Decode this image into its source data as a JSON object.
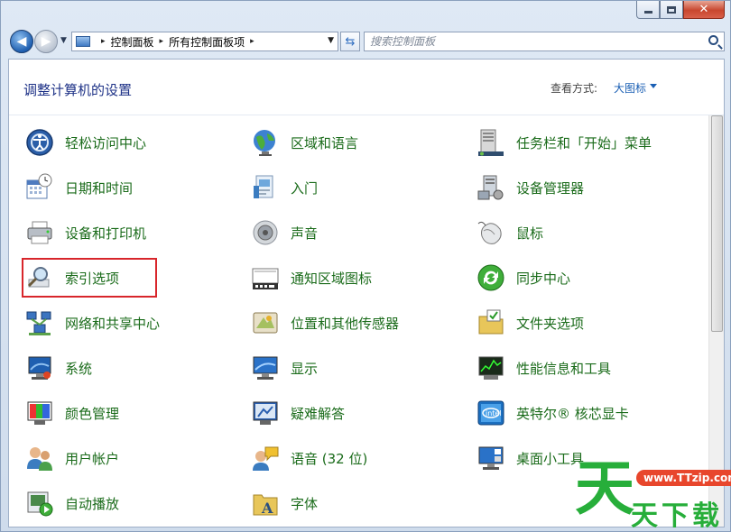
{
  "window": {
    "caption": {
      "min": "–",
      "max": "□",
      "close": "✕"
    }
  },
  "nav": {
    "breadcrumb": [
      "控制面板",
      "所有控制面板项"
    ],
    "sep": "▸",
    "search_placeholder": "搜索控制面板"
  },
  "header": {
    "title": "调整计算机的设置",
    "view_by_label": "查看方式:",
    "view_by_value": "大图标"
  },
  "items": [
    {
      "label": "轻松访问中心",
      "icon": "ease-of-access-icon"
    },
    {
      "label": "区域和语言",
      "icon": "globe-icon"
    },
    {
      "label": "任务栏和「开始」菜单",
      "icon": "taskbar-icon"
    },
    {
      "label": "日期和时间",
      "icon": "calendar-clock-icon"
    },
    {
      "label": "入门",
      "icon": "getting-started-icon"
    },
    {
      "label": "设备管理器",
      "icon": "device-manager-icon"
    },
    {
      "label": "设备和打印机",
      "icon": "printer-icon"
    },
    {
      "label": "声音",
      "icon": "speaker-icon"
    },
    {
      "label": "鼠标",
      "icon": "mouse-icon"
    },
    {
      "label": "索引选项",
      "icon": "indexing-icon"
    },
    {
      "label": "通知区域图标",
      "icon": "notification-area-icon"
    },
    {
      "label": "同步中心",
      "icon": "sync-icon"
    },
    {
      "label": "网络和共享中心",
      "icon": "network-icon"
    },
    {
      "label": "位置和其他传感器",
      "icon": "sensor-icon"
    },
    {
      "label": "文件夹选项",
      "icon": "folder-options-icon"
    },
    {
      "label": "系统",
      "icon": "system-icon"
    },
    {
      "label": "显示",
      "icon": "display-icon"
    },
    {
      "label": "性能信息和工具",
      "icon": "performance-icon"
    },
    {
      "label": "颜色管理",
      "icon": "color-management-icon"
    },
    {
      "label": "疑难解答",
      "icon": "troubleshooting-icon"
    },
    {
      "label": "英特尔® 核芯显卡",
      "icon": "intel-graphics-icon"
    },
    {
      "label": "用户帐户",
      "icon": "user-accounts-icon"
    },
    {
      "label": "语音 (32 位)",
      "icon": "speech-icon"
    },
    {
      "label": "桌面小工具",
      "icon": "gadgets-icon"
    },
    {
      "label": "自动播放",
      "icon": "autoplay-icon"
    },
    {
      "label": "字体",
      "icon": "fonts-icon"
    }
  ],
  "watermark": {
    "big": "天",
    "pill": "www.TTzip.com",
    "sub": "天下载"
  },
  "colors": {
    "link_green": "#1a6b1a",
    "title_blue": "#1e3287",
    "highlight_red": "#d8262b"
  }
}
